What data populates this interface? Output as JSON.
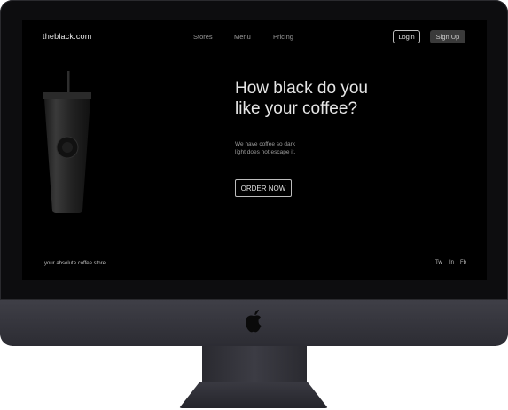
{
  "site": {
    "brand": "theblack.com",
    "nav": [
      "Stores",
      "Menu",
      "Pricing"
    ],
    "login_label": "Login",
    "signup_label": "Sign Up"
  },
  "hero": {
    "headline_line1": "How black do you",
    "headline_line2": "like your coffee?",
    "subtext_line1": "We have coffee so dark",
    "subtext_line2": "light does not escape it.",
    "cta_label": "ORDER NOW"
  },
  "footer": {
    "tagline": "...your absolute coffee store.",
    "social": [
      "Tw",
      "In",
      "Fb"
    ]
  },
  "icons": {
    "product": "black-tumbler-cup",
    "hardware": "apple-logo-icon"
  },
  "colors": {
    "screen_bg": "#000000",
    "bezel": "#0d0d0f",
    "chin": "#3a3a42",
    "text_primary": "#e6e6e6",
    "text_muted": "#9a9a9a",
    "signup_bg": "#3a3a3a"
  }
}
